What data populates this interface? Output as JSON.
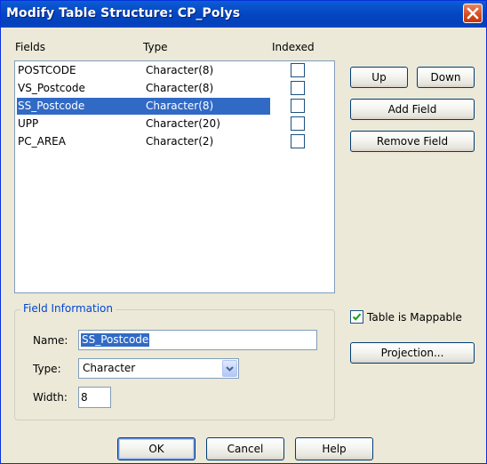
{
  "window": {
    "title": "Modify Table Structure: CP_Polys"
  },
  "columns": {
    "fields": "Fields",
    "type": "Type",
    "indexed": "Indexed"
  },
  "fields": [
    {
      "name": "POSTCODE",
      "type": "Character(8)",
      "indexed": false,
      "selected": false
    },
    {
      "name": "VS_Postcode",
      "type": "Character(8)",
      "indexed": false,
      "selected": false
    },
    {
      "name": "SS_Postcode",
      "type": "Character(8)",
      "indexed": false,
      "selected": true
    },
    {
      "name": "UPP",
      "type": "Character(20)",
      "indexed": false,
      "selected": false
    },
    {
      "name": "PC_AREA",
      "type": "Character(2)",
      "indexed": false,
      "selected": false
    }
  ],
  "buttons": {
    "up": "Up",
    "down": "Down",
    "add_field": "Add Field",
    "remove_field": "Remove Field",
    "projection": "Projection...",
    "ok": "OK",
    "cancel": "Cancel",
    "help": "Help"
  },
  "field_info": {
    "legend": "Field Information",
    "name_label": "Name:",
    "name_value": "SS_Postcode",
    "type_label": "Type:",
    "type_value": "Character",
    "width_label": "Width:",
    "width_value": "8"
  },
  "mappable": {
    "label": "Table is Mappable",
    "checked": true
  },
  "colors": {
    "selection": "#316ac5",
    "titlebar": "#0346c2",
    "legend_text": "#0046d5",
    "dialog_bg": "#ece9d8"
  },
  "icons": {
    "close": "close-icon",
    "dropdown": "chevron-down-icon",
    "check": "checkmark-icon"
  }
}
